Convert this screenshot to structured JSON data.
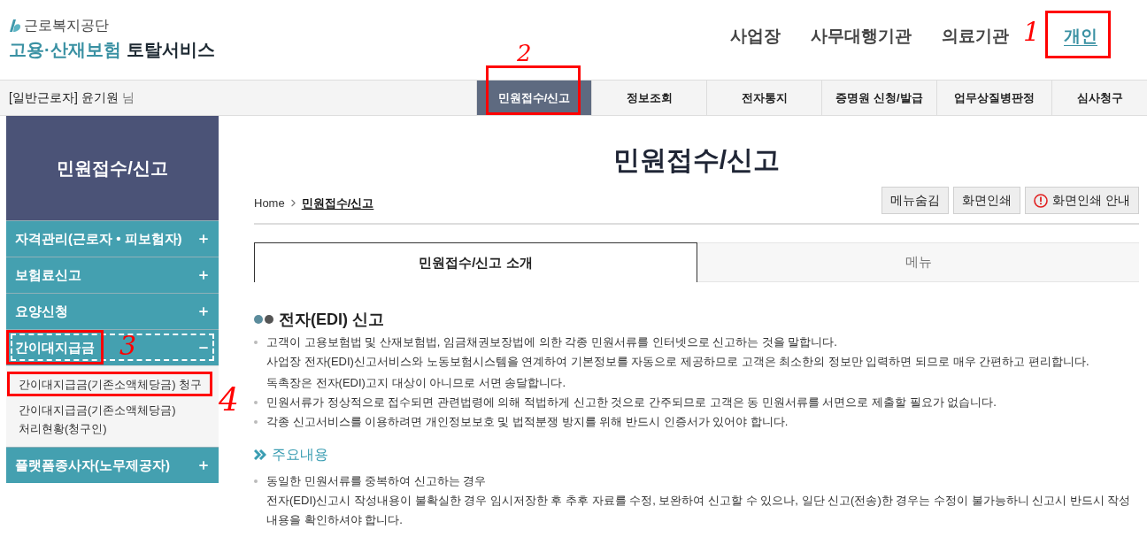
{
  "header": {
    "org_name": "근로복지공단",
    "service_accent": "고용·산재보험",
    "service_name": "토탈서비스",
    "nav": [
      {
        "label": "사업장",
        "selected": false
      },
      {
        "label": "사무대행기관",
        "selected": false
      },
      {
        "label": "의료기관",
        "selected": false
      },
      {
        "label": "개인",
        "selected": true,
        "annotation": "1"
      }
    ]
  },
  "top_bar": {
    "user": "[일반근로자] 윤기원",
    "honorific": "님",
    "menu": [
      {
        "label": "민원접수/신고",
        "selected": true,
        "annotation": "2"
      },
      {
        "label": "정보조회",
        "selected": false
      },
      {
        "label": "전자통지",
        "selected": false
      },
      {
        "label": "증명원 신청/발급",
        "selected": false
      },
      {
        "label": "업무상질병판정",
        "selected": false
      },
      {
        "label": "심사청구",
        "selected": false
      }
    ]
  },
  "sidebar": {
    "title": "민원접수/신고",
    "items": [
      {
        "label": "자격관리(근로자 • 피보험자)",
        "expanded": false,
        "focused": false
      },
      {
        "label": "보험료신고",
        "expanded": false,
        "focused": false
      },
      {
        "label": "요양신청",
        "expanded": false,
        "focused": false
      },
      {
        "label": "간이대지급금",
        "expanded": true,
        "focused": true,
        "annotation": "3",
        "children": [
          {
            "label": "간이대지급금(기존소액체당금) 청구",
            "annotation": "4"
          },
          {
            "label": "간이대지급금(기존소액체당금) 처리현황(청구인)"
          }
        ]
      },
      {
        "label": "플랫폼종사자(노무제공자)",
        "expanded": false,
        "focused": false
      }
    ]
  },
  "main": {
    "title": "민원접수/신고",
    "breadcrumb": [
      "Home",
      "민원접수/신고"
    ],
    "buttons": [
      {
        "label": "메뉴숨김",
        "kind": "plain"
      },
      {
        "label": "화면인쇄",
        "kind": "plain"
      },
      {
        "label": "화면인쇄 안내",
        "kind": "info"
      }
    ],
    "tabs": [
      {
        "label": "민원접수/신고 소개",
        "selected": true
      },
      {
        "label": "메뉴",
        "selected": false
      }
    ],
    "sections": [
      {
        "heading": "전자(EDI) 신고",
        "kind": "dots",
        "items": [
          {
            "lines": [
              "고객이 고용보험법 및 산재보험법, 임금채권보장법에 의한 각종 민원서류를 인터넷으로 신고하는 것을 말합니다.",
              "사업장 전자(EDI)신고서비스와 노동보험시스템을 연계하여 기본정보를 자동으로 제공하므로 고객은 최소한의 정보만 입력하면 되므로 매우 간편하고 편리합니다.",
              "독촉장은 전자(EDI)고지 대상이 아니므로 서면 송달합니다."
            ]
          },
          {
            "lines": [
              "민원서류가 정상적으로 접수되면 관련법령에 의해 적법하게 신고한 것으로 간주되므로 고객은 동 민원서류를 서면으로 제출할 필요가 없습니다."
            ]
          },
          {
            "lines": [
              "각종 신고서비스를 이용하려면 개인정보보호 및 법적분쟁 방지를 위해 반드시 인증서가 있어야 합니다."
            ]
          }
        ]
      },
      {
        "heading": "주요내용",
        "kind": "chevron",
        "items": [
          {
            "lines": [
              "동일한 민원서류를 중복하여 신고하는 경우",
              "전자(EDI)신고시 작성내용이 불확실한 경우 임시저장한 후 추후 자료를 수정, 보완하여 신고할 수 있으나, 일단 신고(전송)한 경우는 수정이 불가능하니 신고시 반드시 작성내용을 확인하셔야 합니다."
            ]
          }
        ]
      }
    ]
  }
}
